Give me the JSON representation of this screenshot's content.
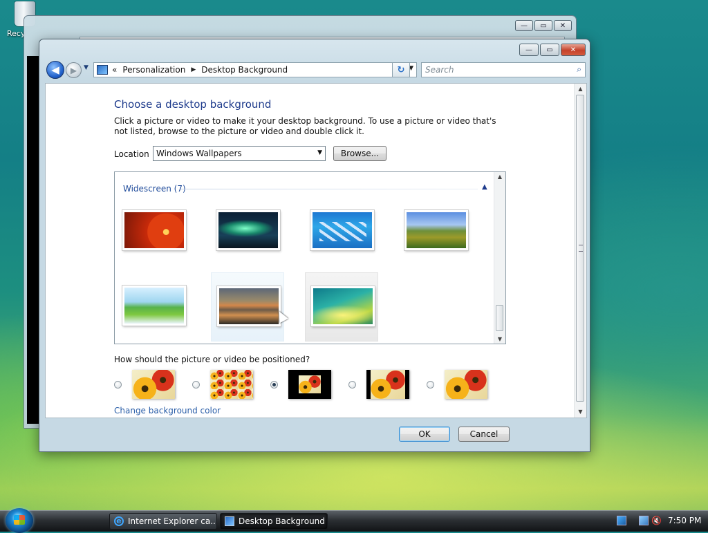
{
  "desktop": {
    "recycle_label": "Recy"
  },
  "window": {
    "controls": {
      "minimize": "—",
      "maximize": "▭",
      "close": "✕"
    },
    "nav": {
      "back_glyph": "◀",
      "forward_glyph": "▶",
      "history_glyph": "▼",
      "breadcrumb_prefix": "«",
      "breadcrumbs": [
        "Personalization",
        "Desktop Background"
      ],
      "crumb_sep": "▶",
      "addr_drop": "▼",
      "refresh_glyph": "↻",
      "search_placeholder": "Search",
      "search_icon": "⌕"
    },
    "heading": "Choose a desktop background",
    "description": "Click a picture or video to make it your desktop background. To use a picture or video that's not listed, browse to the picture or video and double click it.",
    "location": {
      "label": "Location",
      "selected": "Windows Wallpapers",
      "drop": "▼",
      "browse_label": "Browse..."
    },
    "gallery": {
      "group_title": "Widescreen (7)",
      "collapse_glyph": "▲",
      "scroll_up": "▲",
      "scroll_down": "▼",
      "images": [
        {
          "name": "red-gerbera-wallpaper"
        },
        {
          "name": "aurora-wallpaper"
        },
        {
          "name": "fish-school-wallpaper"
        },
        {
          "name": "green-hills-wallpaper"
        },
        {
          "name": "palm-leaf-wallpaper"
        },
        {
          "name": "mountain-lake-wallpaper"
        },
        {
          "name": "vista-aurora-wallpaper"
        }
      ]
    },
    "position": {
      "question": "How should the picture or video be positioned?",
      "options": [
        {
          "name": "fill",
          "checked": false
        },
        {
          "name": "tile",
          "checked": false
        },
        {
          "name": "center",
          "checked": true
        },
        {
          "name": "fit",
          "checked": false
        },
        {
          "name": "stretch",
          "checked": false
        }
      ]
    },
    "change_color_link": "Change background color",
    "buttons": {
      "ok": "OK",
      "cancel": "Cancel"
    }
  },
  "taskbar": {
    "tasks": [
      {
        "label": "Internet Explorer ca...",
        "active": false
      },
      {
        "label": "Desktop Background",
        "active": true
      }
    ],
    "volume_glyph": "🔇",
    "clock": "7:50 PM"
  }
}
